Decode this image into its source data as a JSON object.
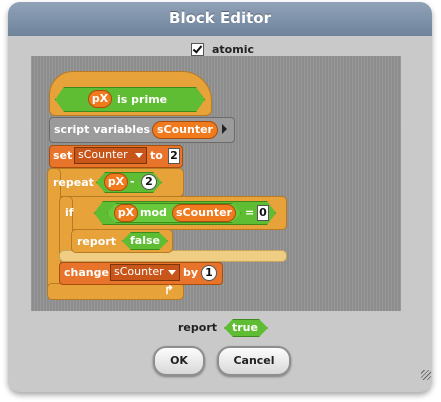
{
  "dialog": {
    "title": "Block Editor",
    "atomic_label": "atomic",
    "atomic_checked": true
  },
  "script": {
    "hat": {
      "param": "pX",
      "label": "is prime"
    },
    "script_variables": {
      "label": "script variables",
      "var": "sCounter"
    },
    "set": {
      "label": "set",
      "var": "sCounter",
      "to": "to",
      "value": "2"
    },
    "repeat": {
      "label": "repeat",
      "var": "pX",
      "minus": "-",
      "value": "2"
    },
    "if_block": {
      "label": "if",
      "var": "pX",
      "op": "mod",
      "var2": "sCounter",
      "eq": "=",
      "value": "0",
      "report_label": "report",
      "report_value": "false"
    },
    "change": {
      "label": "change",
      "var": "sCounter",
      "by": "by",
      "value": "1"
    }
  },
  "footer": {
    "report_label": "report",
    "report_value": "true",
    "ok_label": "OK",
    "cancel_label": "Cancel"
  },
  "colors": {
    "title_bar": "#7f93aa",
    "dialog_bg": "#c9c9c9",
    "script_bg": "#8d8d8d",
    "hat": "#e8a23a",
    "variables": "#f07a1e",
    "operators": "#5fbd34",
    "control": "#e8a23a"
  }
}
